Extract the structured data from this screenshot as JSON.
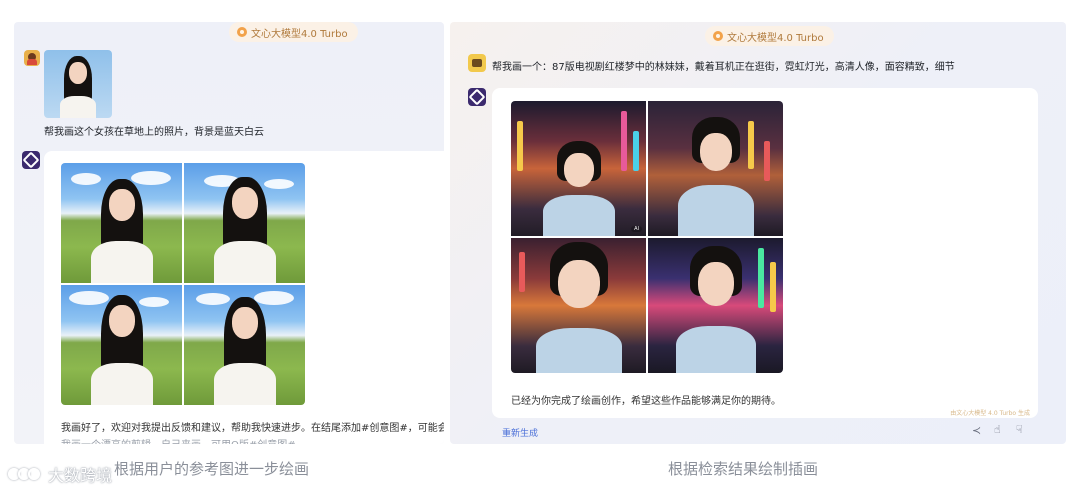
{
  "left": {
    "badge": "文心大模型4.0 Turbo",
    "user_prompt": "帮我画这个女孩在草地上的照片，背景是蓝天白云",
    "reply": "我画好了，欢迎对我提出反馈和建议，帮助我快速进步。在结尾添加#创意图#，可能会解锁小彩",
    "reply_cut": "我画一个漂亮的剪辑，自己来画，可用Q版#创意图#",
    "caption": "根据用户的参考图进一步绘画"
  },
  "right": {
    "badge": "文心大模型4.0 Turbo",
    "user_prompt": "帮我画一个：87版电视剧红楼梦中的林妹妹，戴着耳机正在逛街，霓虹灯光，高清人像，面容精致，细节",
    "reply": "已经为你完成了绘画创作，希望这些作品能够满足你的期待。",
    "footer_note": "由文心大模型 4.0 Turbo 生成",
    "regenerate": "重新生成",
    "caption": "根据检索结果绘制插画"
  },
  "watermark": "大数跨境",
  "icons": [
    "badge-icon",
    "user-avatar",
    "bot-avatar",
    "share-icon",
    "thumbs-up-icon",
    "thumbs-down-icon",
    "watermark-logo-icon"
  ]
}
